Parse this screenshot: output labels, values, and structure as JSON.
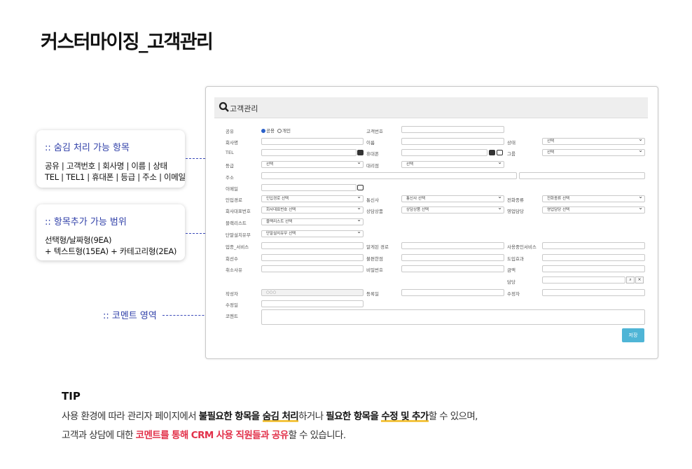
{
  "page_title": "커스터마이징_고객관리",
  "callouts": {
    "hide": {
      "title": ":: 숨김 처리 가능 항목",
      "lines": [
        "공유 | 고객번호 | 회사명 | 이름 | 상태",
        "TEL | TEL1 | 휴대폰 | 등급 | 주소 | 이메일"
      ]
    },
    "add": {
      "title": ":: 항목추가 가능 범위",
      "lines": [
        "선택형/날짜형(9EA)",
        "+ 텍스트형(15EA) + 카테고리형(2EA)"
      ]
    },
    "comment": {
      "title": ":: 코멘트 영역"
    }
  },
  "window": {
    "title": "고객관리",
    "search_icon": "search-icon",
    "labels": {
      "share": "공유",
      "customer_no": "고객번호",
      "company": "회사명",
      "name": "이름",
      "status": "상태",
      "tel": "TEL",
      "mobile": "휴대폰",
      "group": "그룹",
      "grade": "등급",
      "agency": "대리점",
      "address": "주소",
      "email": "이메일",
      "inflow": "인입경로",
      "carrier": "통신사",
      "phone_type": "전화종류",
      "rep_no": "회사대표번호",
      "consult_product": "상담상품",
      "sales_manager": "영업담당",
      "blacklist": "블랙리스트",
      "terminal_reason": "단말설치유무",
      "biz_service": "업종_서비스",
      "recall_route": "알게된 경로",
      "in_use_service": "사용중인서비스",
      "line_count": "회선수",
      "inconvenience": "불편한점",
      "intro_effect": "도입효과",
      "cancel_reason": "취소사유",
      "password": "비밀번호",
      "amount": "금액",
      "manager": "담당",
      "writer": "작성자",
      "reg_date": "등록일",
      "editor": "수정자",
      "edit_date": "수정일",
      "comment": "코멘트"
    },
    "radio": {
      "public": "공용",
      "private": "개인"
    },
    "selects": {
      "status": "선택",
      "group": "선택",
      "grade": "선택",
      "agency": "선택",
      "inflow": "인입경로 선택",
      "carrier": "통신사 선택",
      "phone_type": "전화종류 선택",
      "rep_no": "회사대표번호 선택",
      "consult_product": "상담상품 선택",
      "sales_manager": "영업담당 선택",
      "blacklist": "블랙리스트 선택",
      "terminal_reason": "단말설치유무 선택"
    },
    "writer_value": "○○○",
    "manager_search": "search-icon",
    "manager_clear": "close-icon",
    "save_label": "저장"
  },
  "tip": {
    "heading": "TIP",
    "line1": [
      "사용 환경에 따라 관리자 페이지에서 ",
      "불필요한 항목을 ",
      "숨김 처리",
      "하거나 ",
      "필요한 항목을 ",
      "수정 및 추가",
      "할 수 있으며,"
    ],
    "line2": [
      "고객과 상담에 대한 ",
      "코멘트를 통해 CRM 사용 직원들과 공유",
      "할 수 있습니다."
    ]
  }
}
